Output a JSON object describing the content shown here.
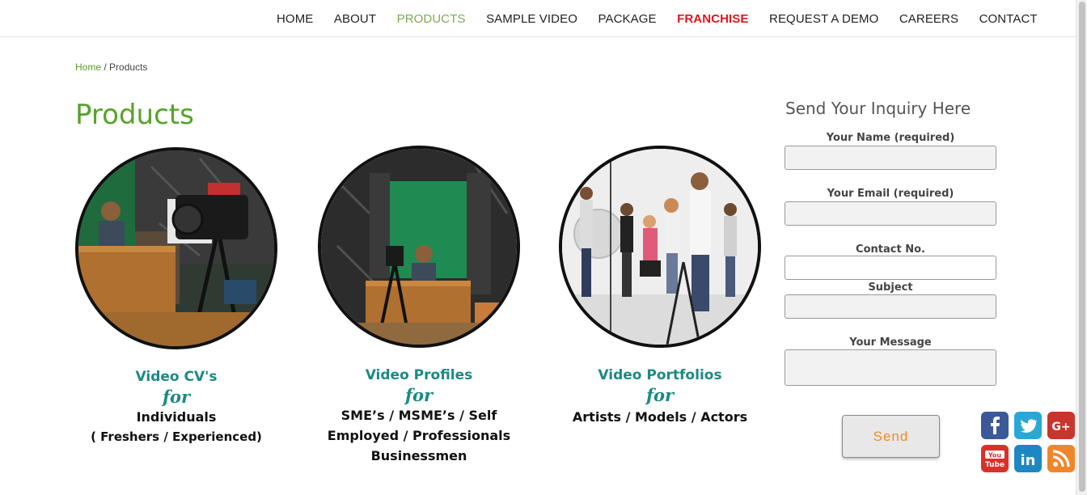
{
  "nav": {
    "items": [
      {
        "label": "HOME"
      },
      {
        "label": "ABOUT"
      },
      {
        "label": "PRODUCTS"
      },
      {
        "label": "SAMPLE VIDEO"
      },
      {
        "label": "PACKAGE"
      },
      {
        "label": "FRANCHISE"
      },
      {
        "label": "REQUEST A DEMO"
      },
      {
        "label": "CAREERS"
      },
      {
        "label": "CONTACT"
      }
    ],
    "active_color": "#7fa85a",
    "franchise_color": "#e0151c"
  },
  "breadcrumb": {
    "home": "Home",
    "separator": "/",
    "current": "Products"
  },
  "page_title": "Products",
  "products": [
    {
      "title": "Video CV's",
      "for": "for",
      "line1": "Individuals",
      "line2": "( Freshers / Experienced)"
    },
    {
      "title": "Video Profiles",
      "for": "for",
      "line1": "SME’s / MSME’s / Self",
      "line2": "Employed / Professionals",
      "line3": "Businessmen"
    },
    {
      "title": "Video Portfolios",
      "for": "for",
      "line1": "Artists / Models / Actors"
    }
  ],
  "form": {
    "heading": "Send Your Inquiry Here",
    "name_label": "Your Name (required)",
    "email_label": "Your Email (required)",
    "contact_label": "Contact No.",
    "subject_label": "Subject",
    "message_label": "Your Message",
    "send_label": "Send",
    "name_value": "",
    "email_value": "",
    "contact_value": "",
    "subject_value": "",
    "message_value": ""
  },
  "social": {
    "icons": [
      "facebook-icon",
      "twitter-icon",
      "google-plus-icon",
      "youtube-icon",
      "linkedin-icon",
      "rss-icon"
    ],
    "youtube_text_top": "You",
    "youtube_text_bottom": "Tube",
    "linkedin_text": "in",
    "google_text": "G+"
  },
  "colors": {
    "green_title": "#55a32a",
    "teal": "#1a8a83",
    "send_text": "#f08a24"
  }
}
